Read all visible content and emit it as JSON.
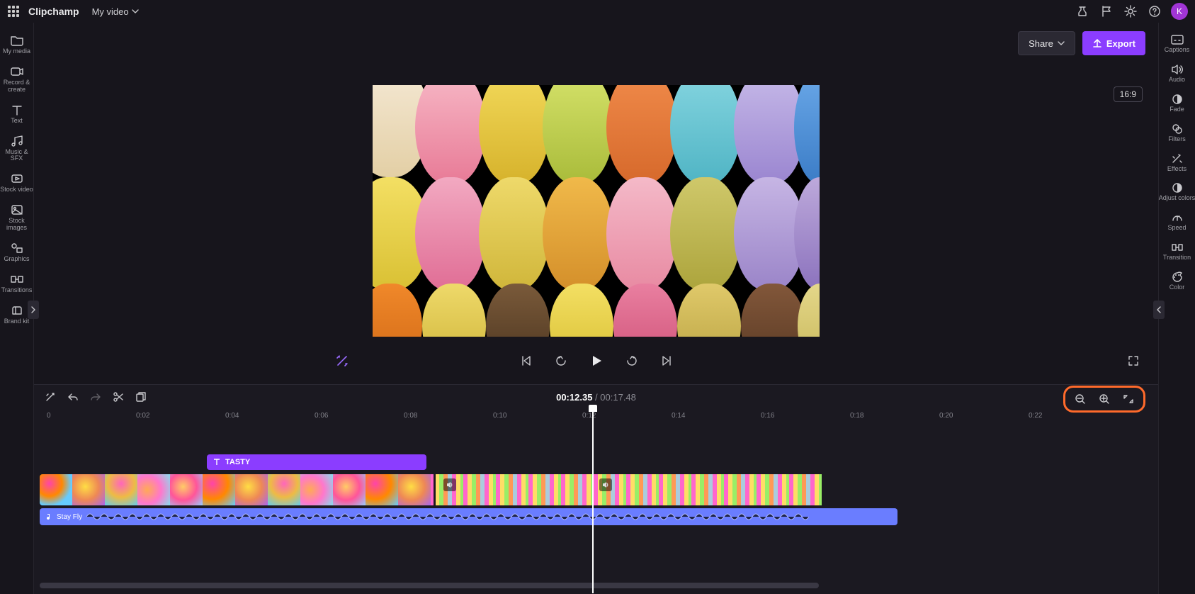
{
  "app": {
    "brand": "Clipchamp",
    "project_name": "My video",
    "avatar_initial": "K"
  },
  "top_actions": {
    "share": "Share",
    "export": "Export",
    "aspect": "16:9"
  },
  "left_sidebar": [
    {
      "id": "my-media",
      "label": "My media"
    },
    {
      "id": "record-create",
      "label": "Record & create"
    },
    {
      "id": "text",
      "label": "Text"
    },
    {
      "id": "music-sfx",
      "label": "Music & SFX"
    },
    {
      "id": "stock-video",
      "label": "Stock video"
    },
    {
      "id": "stock-images",
      "label": "Stock images"
    },
    {
      "id": "graphics",
      "label": "Graphics"
    },
    {
      "id": "transitions",
      "label": "Transitions"
    },
    {
      "id": "brand-kit",
      "label": "Brand kit"
    }
  ],
  "right_sidebar": [
    {
      "id": "captions",
      "label": "Captions"
    },
    {
      "id": "audio",
      "label": "Audio"
    },
    {
      "id": "fade",
      "label": "Fade"
    },
    {
      "id": "filters",
      "label": "Filters"
    },
    {
      "id": "effects",
      "label": "Effects"
    },
    {
      "id": "adjust-colors",
      "label": "Adjust colors"
    },
    {
      "id": "speed",
      "label": "Speed"
    },
    {
      "id": "transition",
      "label": "Transition"
    },
    {
      "id": "color",
      "label": "Color"
    }
  ],
  "playback": {
    "current": "00:12.35",
    "total": "00:17.48"
  },
  "ruler": [
    "0",
    "0:02",
    "0:04",
    "0:06",
    "0:08",
    "0:10",
    "0:12",
    "0:14",
    "0:16",
    "0:18",
    "0:20",
    "0:22"
  ],
  "timeline": {
    "text_clip_label": "TASTY",
    "audio_clip_label": "Stay Fly"
  }
}
